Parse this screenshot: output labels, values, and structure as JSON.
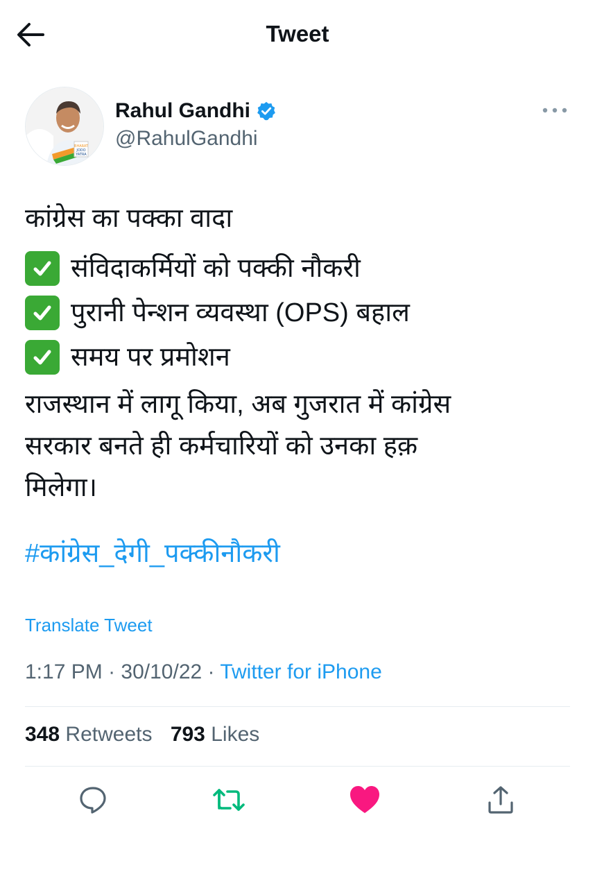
{
  "header": {
    "title": "Tweet"
  },
  "author": {
    "name": "Rahul Gandhi",
    "handle": "@RahulGandhi",
    "verified": true
  },
  "tweet": {
    "intro": "कांग्रेस का पक्का वादा",
    "checklist": [
      "संविदाकर्मियों को पक्की नौकरी",
      "पुरानी पेन्शन व्यवस्था (OPS) बहाल",
      "समय पर प्रमोशन"
    ],
    "body_lines": [
      "राजस्थान में लागू किया, अब गुजरात में कांग्रेस",
      "सरकार बनते ही कर्मचारियों को उनका हक़",
      "मिलेगा।"
    ],
    "hashtag": "#कांग्रेस_देगी_पक्कीनौकरी"
  },
  "translate_label": "Translate Tweet",
  "meta": {
    "time": "1:17 PM",
    "sep": " · ",
    "date": "30/10/22",
    "sep2": " · ",
    "source": "Twitter for iPhone"
  },
  "stats": {
    "retweets_count": "348",
    "retweets_label": "Retweets",
    "likes_count": "793",
    "likes_label": "Likes"
  },
  "colors": {
    "accent": "#1d9bf0",
    "like": "#f91880",
    "retweet": "#00ba7c",
    "check": "#3aa935",
    "muted": "#536471"
  },
  "icons": [
    "back-arrow-icon",
    "verified-badge-icon",
    "more-icon",
    "reply-icon",
    "retweet-icon",
    "like-icon",
    "share-icon"
  ]
}
